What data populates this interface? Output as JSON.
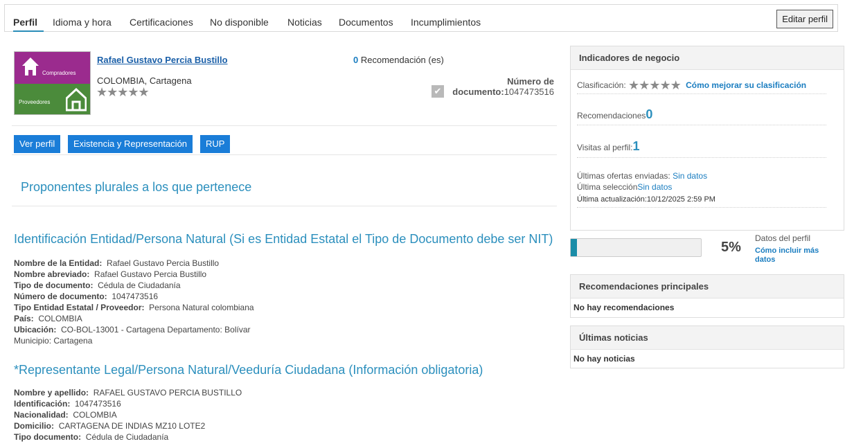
{
  "tabs": [
    {
      "label": "Perfil",
      "active": true
    },
    {
      "label": "Idioma y hora"
    },
    {
      "label": "Certificaciones"
    },
    {
      "label": "No disponible"
    },
    {
      "label": "Noticias"
    },
    {
      "label": "Documentos"
    },
    {
      "label": "Incumplimientos"
    }
  ],
  "edit_profile_label": "Editar perfil",
  "logo": {
    "top_text": "Compradores",
    "bottom_text": "Proveedores",
    "top_color": "#9b2b8e",
    "bottom_color": "#4b8b3b"
  },
  "profile": {
    "name": "Rafael Gustavo Percia Bustillo",
    "location": "COLOMBIA, Cartagena",
    "stars": "★★★★★",
    "recommendations_count": "0",
    "recommendations_label": " Recomendación (es)",
    "doc_label_1": "Número de",
    "doc_label_2": "documento:",
    "doc_number": "1047473516"
  },
  "buttons": {
    "ver_perfil": "Ver perfil",
    "existencia": "Existencia y Representación",
    "rup": "RUP"
  },
  "plural_title": "Proponentes plurales a los que pertenece",
  "ident_section": {
    "title": "Identificación Entidad/Persona Natural (Si es Entidad Estatal el Tipo de Documento debe ser NIT)",
    "fields": [
      {
        "label": "Nombre de la Entidad:",
        "value": "Rafael Gustavo Percia Bustillo"
      },
      {
        "label": "Nombre abreviado:",
        "value": "Rafael Gustavo Percia Bustillo"
      },
      {
        "label": "Tipo de documento:",
        "value": "Cédula de Ciudadanía"
      },
      {
        "label": "Número de documento:",
        "value": "1047473516"
      },
      {
        "label": "Tipo Entidad Estatal / Proveedor:",
        "value": "Persona Natural colombiana"
      },
      {
        "label": "País:",
        "value": "COLOMBIA"
      },
      {
        "label": "Ubicación:",
        "value": "CO-BOL-13001 - Cartagena Departamento: Bolívar"
      },
      {
        "label": "",
        "value": "Municipio: Cartagena"
      }
    ]
  },
  "rep_section": {
    "title": "*Representante Legal/Persona Natural/Veeduría Ciudadana (Información obligatoria)",
    "fields": [
      {
        "label": "Nombre y apellido:",
        "value": "RAFAEL GUSTAVO PERCIA BUSTILLO"
      },
      {
        "label": "Identificación:",
        "value": "1047473516"
      },
      {
        "label": "Nacionalidad:",
        "value": "COLOMBIA"
      },
      {
        "label": "Domicilio:",
        "value": "CARTAGENA DE INDIAS MZ10 LOTE2"
      },
      {
        "label": "Tipo documento:",
        "value": "Cédula de Ciudadanía"
      }
    ]
  },
  "indicators": {
    "title": "Indicadores de negocio",
    "clasificacion_label": "Clasificación:",
    "stars": "★★★★★",
    "improve_link": "Cómo mejorar su clasificación",
    "recomendaciones_label": "Recomendaciones",
    "recomendaciones_value": "0",
    "visitas_label": "Visitas al perfil:",
    "visitas_value": "1",
    "ofertas_label": "Últimas ofertas enviadas: ",
    "ofertas_value": "Sin datos",
    "seleccion_label": "Última selección",
    "seleccion_value": "Sin datos",
    "actualizacion": "Última actualización:10/12/2025 2:59 PM"
  },
  "profile_data": {
    "title": "Datos del perfil",
    "percent_text": "5%",
    "percent": 0.05,
    "link": "Cómo incluir más datos"
  },
  "top_recommendations": {
    "title": "Recomendaciones principales",
    "empty": "No hay recomendaciones"
  },
  "latest_news": {
    "title": "Últimas noticias",
    "empty": "No hay noticias"
  },
  "colors": {
    "accent": "#1a7dd8",
    "teal": "#2b8fbd",
    "progress": "#1a8da8"
  }
}
